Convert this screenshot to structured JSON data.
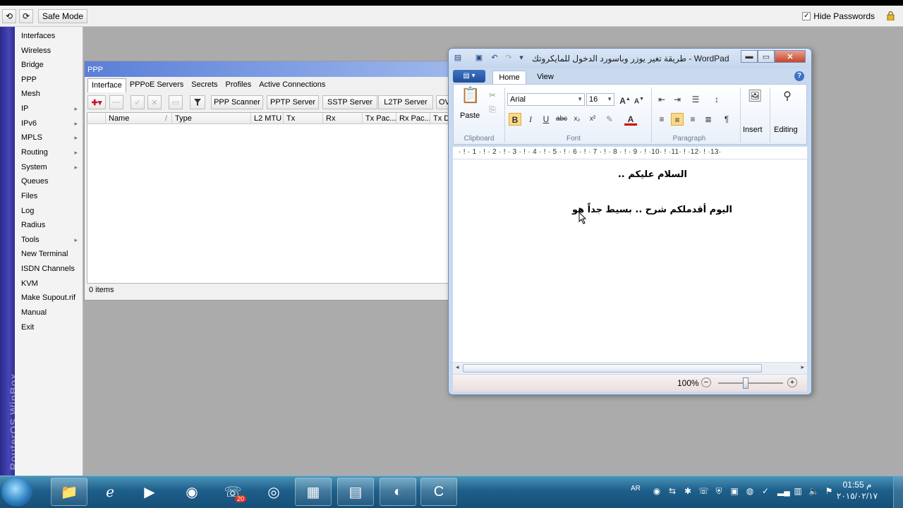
{
  "winbox": {
    "toolbar": {
      "undo_icon": "undo-icon",
      "redo_icon": "redo-icon",
      "safe_mode_label": "Safe Mode",
      "hide_passwords_label": "Hide Passwords",
      "hide_passwords_checked": "✓"
    },
    "brand": "RouterOS WinBox",
    "menu": [
      {
        "label": "Interfaces",
        "submenu": false
      },
      {
        "label": "Wireless",
        "submenu": false
      },
      {
        "label": "Bridge",
        "submenu": false
      },
      {
        "label": "PPP",
        "submenu": false
      },
      {
        "label": "Mesh",
        "submenu": false
      },
      {
        "label": "IP",
        "submenu": true
      },
      {
        "label": "IPv6",
        "submenu": true
      },
      {
        "label": "MPLS",
        "submenu": true
      },
      {
        "label": "Routing",
        "submenu": true
      },
      {
        "label": "System",
        "submenu": true
      },
      {
        "label": "Queues",
        "submenu": false
      },
      {
        "label": "Files",
        "submenu": false
      },
      {
        "label": "Log",
        "submenu": false
      },
      {
        "label": "Radius",
        "submenu": false
      },
      {
        "label": "Tools",
        "submenu": true
      },
      {
        "label": "New Terminal",
        "submenu": false
      },
      {
        "label": "ISDN Channels",
        "submenu": false
      },
      {
        "label": "KVM",
        "submenu": false
      },
      {
        "label": "Make Supout.rif",
        "submenu": false
      },
      {
        "label": "Manual",
        "submenu": false
      },
      {
        "label": "Exit",
        "submenu": false
      }
    ],
    "submenu_arrow": "▸"
  },
  "ppp": {
    "title": "PPP",
    "tabs": [
      "Interface",
      "PPPoE Servers",
      "Secrets",
      "Profiles",
      "Active Connections"
    ],
    "active_tab": "Interface",
    "toolbar": {
      "add_label": "✚▾",
      "filter_icon": "filter-icon",
      "buttons": [
        "PPP Scanner",
        "PPTP Server",
        "SSTP Server",
        "L2TP Server",
        "OV"
      ]
    },
    "columns": [
      "Name",
      "Type",
      "L2 MTU",
      "Tx",
      "Rx",
      "Tx Pac...",
      "Rx Pac...",
      "Tx Dr"
    ],
    "sort_marker": "/",
    "status": "0 items"
  },
  "wordpad": {
    "title": "طريقة تغير يوزر وباسورد الدخول للمايكروتك - WordPad",
    "tabs": [
      "Home",
      "View"
    ],
    "active_tab": "Home",
    "file_button": "▤ ▾",
    "help": "?",
    "clipboard": {
      "paste_label": "Paste",
      "group_label": "Clipboard"
    },
    "font": {
      "family": "Arial",
      "size": "16",
      "group_label": "Font"
    },
    "paragraph": {
      "group_label": "Paragraph"
    },
    "insert_label": "Insert",
    "editing_label": "Editing",
    "ruler": "· ! · 1 · ! · 2 · ! · 3 · ! · 4 · ! · 5 · ! · 6 · ! · 7 · ! · 8 · ! · 9 · ! ·10· ! ·11· ! ·12· ! ·13·",
    "document_lines": [
      "السلام عليكم ..",
      "اليوم أقدملكم شرح .. بسيط جداً هو"
    ],
    "zoom": "100%",
    "zoom_level_percent": 100,
    "buttons": {
      "minimize": "▬",
      "maximize": "▭",
      "close": "✕"
    }
  },
  "taskbar": {
    "apps": [
      "folder-icon",
      "ie-icon",
      "media-player-icon",
      "browser-icon",
      "viber-icon",
      "chrome-icon",
      "explorer-icon",
      "wordpad-icon",
      "teamviewer-icon",
      "camtasia-icon"
    ],
    "viber_badge": "20",
    "language": "AR",
    "time": "01:55 م",
    "date": "٢٠١٥/٠٢/١٧"
  }
}
